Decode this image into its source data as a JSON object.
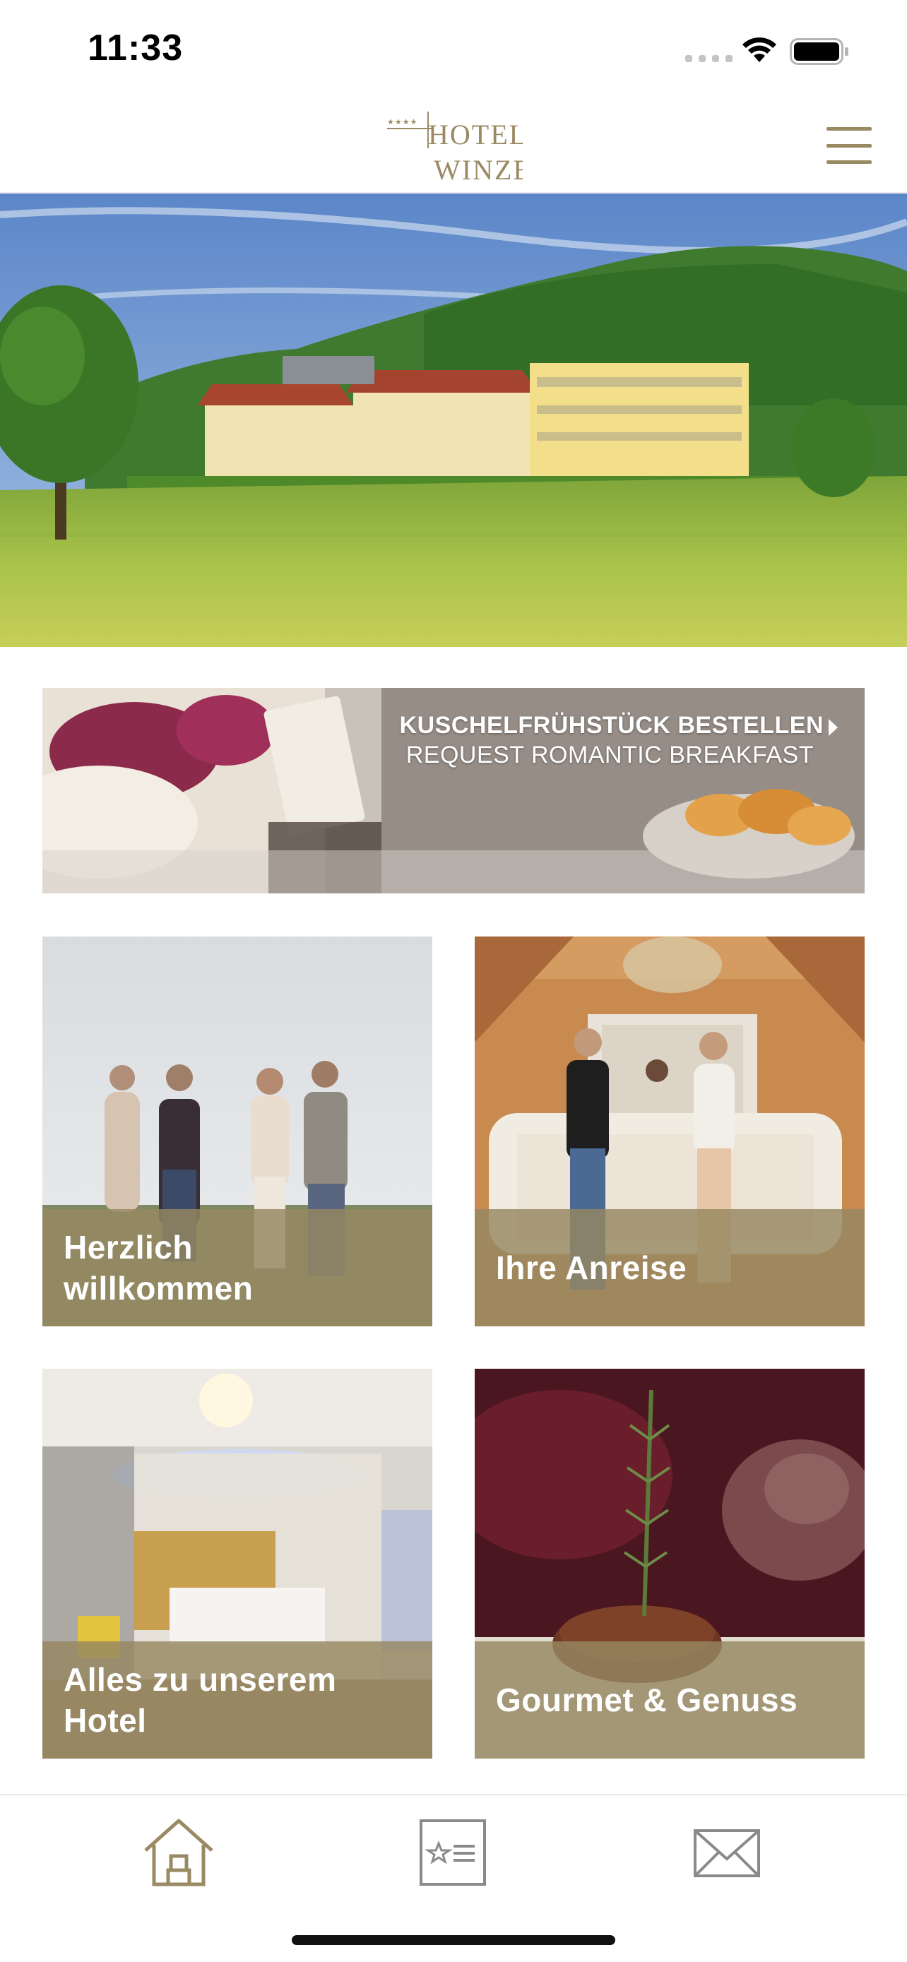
{
  "status_bar": {
    "time": "11:33"
  },
  "header": {
    "logo_name": "Hotel Winzer",
    "logo_line1": "HOTEL",
    "logo_line2": "WINZER",
    "logo_stars": "★★★★",
    "menu_icon": "hamburger-menu-icon"
  },
  "hero": {
    "image": "hotel-exterior-photo"
  },
  "banner": {
    "title": "KUSCHELFRÜHSTÜCK BESTELLEN",
    "subtitle": "REQUEST ROMANTIC BREAKFAST",
    "icon": "chevron-right-icon"
  },
  "tiles": [
    {
      "label_line1": "Herzlich",
      "label_line2": "willkommen"
    },
    {
      "label_line1": "Ihre Anreise",
      "label_line2": ""
    },
    {
      "label_line1": "Alles zu unserem",
      "label_line2": "Hotel"
    },
    {
      "label_line1": "Gourmet & Genuss",
      "label_line2": ""
    }
  ],
  "tab_bar": {
    "tabs": [
      {
        "icon": "home-icon",
        "active": true
      },
      {
        "icon": "rated-list-icon",
        "active": false
      },
      {
        "icon": "mail-icon",
        "active": false
      }
    ]
  },
  "colors": {
    "accent": "#9a8a64",
    "caption_overlay": "#968762",
    "inactive_icon": "#8a8a8a"
  }
}
